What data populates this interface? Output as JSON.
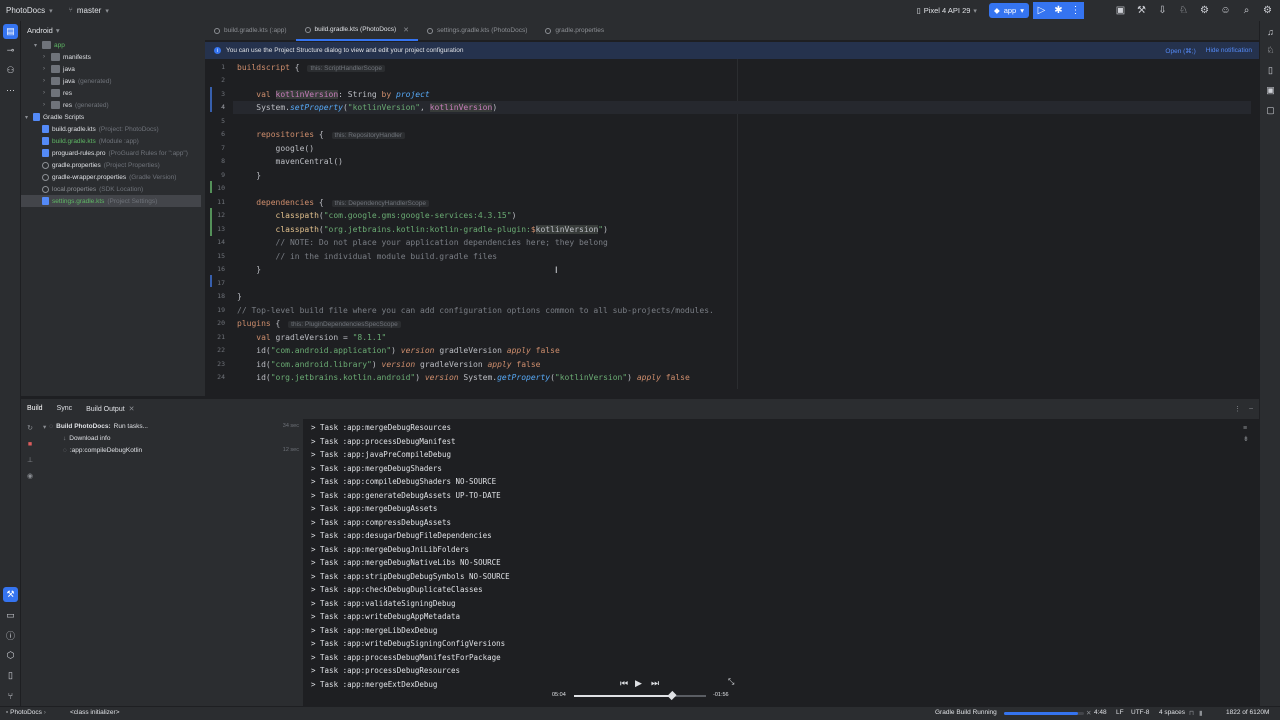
{
  "titlebar": {
    "project": "PhotoDocs",
    "branch": "master",
    "device": "Pixel 4 API 29",
    "run_config": "app"
  },
  "project_panel": {
    "view": "Android",
    "tree": [
      {
        "label": "app",
        "hint": "",
        "icon": "module-folder-icon"
      },
      {
        "label": "manifests",
        "hint": "",
        "icon": "folder-icon"
      },
      {
        "label": "java",
        "hint": "",
        "icon": "folder-icon"
      },
      {
        "label": "java",
        "hint": "(generated)",
        "icon": "folder-icon"
      },
      {
        "label": "res",
        "hint": "",
        "icon": "folder-icon"
      },
      {
        "label": "res",
        "hint": "(generated)",
        "icon": "folder-icon"
      },
      {
        "label": "Gradle Scripts",
        "hint": "",
        "icon": "gradle-icon"
      },
      {
        "label": "build.gradle.kts",
        "hint": "(Project: PhotoDocs)",
        "icon": "gradle-file-icon"
      },
      {
        "label": "build.gradle.kts",
        "hint": "(Module :app)",
        "icon": "gradle-file-icon"
      },
      {
        "label": "proguard-rules.pro",
        "hint": "(ProGuard Rules for \":app\")",
        "icon": "file-icon"
      },
      {
        "label": "gradle.properties",
        "hint": "(Project Properties)",
        "icon": "gear-icon"
      },
      {
        "label": "gradle-wrapper.properties",
        "hint": "(Gradle Version)",
        "icon": "gear-icon"
      },
      {
        "label": "local.properties",
        "hint": "(SDK Location)",
        "icon": "gear-icon"
      },
      {
        "label": "settings.gradle.kts",
        "hint": "(Project Settings)",
        "icon": "gradle-file-icon"
      }
    ]
  },
  "tabs": [
    {
      "label": "build.gradle.kts (:app)"
    },
    {
      "label": "build.gradle.kts (PhotoDocs)",
      "active": true
    },
    {
      "label": "settings.gradle.kts (PhotoDocs)"
    },
    {
      "label": "gradle.properties"
    }
  ],
  "notice": {
    "text": "You can use the Project Structure dialog to view and edit your project configuration",
    "open_link": "Open (⌘;)",
    "hide_link": "Hide notification"
  },
  "editor": {
    "line_numbers": [
      "1",
      "2",
      "3",
      "4",
      "5",
      "6",
      "7",
      "8",
      "9",
      "10",
      "11",
      "12",
      "13",
      "14",
      "15",
      "16",
      "17",
      "18",
      "19",
      "20",
      "21",
      "22",
      "23",
      "24"
    ],
    "hints": {
      "buildscript": "this: ScriptHandlerScope",
      "repositories": "this: RepositoryHandler",
      "dependencies": "this: DependencyHandlerScope",
      "plugins": "this: PluginDependenciesSpecScope"
    }
  },
  "build_window": {
    "tabs": {
      "build": "Build",
      "sync": "Sync",
      "output": "Build Output"
    },
    "tree": [
      {
        "label": "Build PhotoDocs:",
        "detail": "Run tasks...",
        "time": "34 sec"
      },
      {
        "label": "Download info",
        "detail": "",
        "time": ""
      },
      {
        "label": ":app:compileDebugKotlin",
        "detail": "",
        "time": "12 sec"
      }
    ],
    "output": [
      "> Task :app:mergeDebugResources",
      "> Task :app:processDebugManifest",
      "> Task :app:javaPreCompileDebug",
      "> Task :app:mergeDebugShaders",
      "> Task :app:compileDebugShaders NO-SOURCE",
      "> Task :app:generateDebugAssets UP-TO-DATE",
      "> Task :app:mergeDebugAssets",
      "> Task :app:compressDebugAssets",
      "> Task :app:desugarDebugFileDependencies",
      "> Task :app:mergeDebugJniLibFolders",
      "> Task :app:mergeDebugNativeLibs NO-SOURCE",
      "> Task :app:stripDebugDebugSymbols NO-SOURCE",
      "> Task :app:checkDebugDuplicateClasses",
      "> Task :app:validateSigningDebug",
      "> Task :app:writeDebugAppMetadata",
      "> Task :app:mergeLibDexDebug",
      "> Task :app:writeDebugSigningConfigVersions",
      "> Task :app:processDebugManifestForPackage",
      "> Task :app:processDebugResources",
      "> Task :app:mergeExtDexDebug"
    ]
  },
  "media": {
    "elapsed": "05:04",
    "remaining": "-01:56",
    "progress": 0.74
  },
  "statusbar": {
    "breadcrumb_project": "PhotoDocs",
    "breadcrumb_context": "<class initializer>",
    "task": "Gradle Build Running",
    "task_progress": 0.92,
    "position": "4:48",
    "line_ending": "LF",
    "encoding": "UTF-8",
    "indent": "4 spaces",
    "memory": "1822 of 6120M"
  },
  "colors": {
    "accent": "#3574f0",
    "background": "#1e1f22",
    "panel": "#2b2d30"
  }
}
